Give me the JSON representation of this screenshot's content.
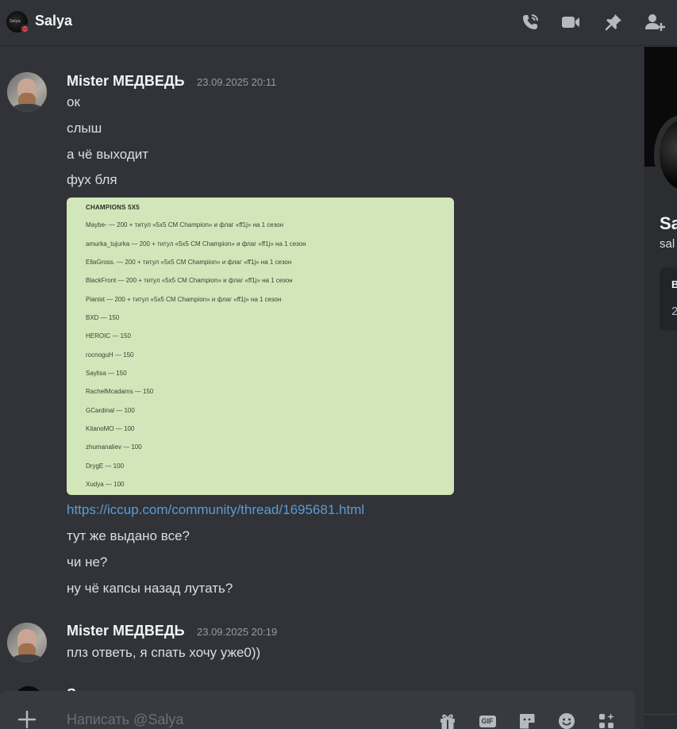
{
  "header": {
    "title": "Salya",
    "avatar_text": "Salya",
    "icons": [
      "phone-call-icon",
      "video-camera-icon",
      "pin-icon",
      "add-friend-icon"
    ]
  },
  "messages": [
    {
      "author": "Mister МЕДВЕДЬ",
      "timestamp": "23.09.2025 20:11",
      "lines": [
        "ок",
        "слыш",
        "а чё выходит",
        "фух бля"
      ],
      "attachment": {
        "title": "CHAMPIONS 5X5",
        "rows": [
          "Maybe- — 200 + титул «5x5 CM Champion» и флаг «ff1j» на 1 сезон",
          "amurka_tujurka — 200 + титул «5x5 CM Champion» и флаг «ff1j» на 1 сезон",
          "EllaGross. — 200 + титул «5x5 CM Champion» и флаг «ff1j» на 1 сезон",
          "BlackFront — 200 + титул «5x5 CM Champion» и флаг «ff1j» на 1 сезон",
          "Pianist — 200 + титул «5x5 CM Champion» и флаг «ff1j» на 1 сезон",
          "BXD — 150",
          "HEROIC — 150",
          "rocnoguH — 150",
          "Saylisa — 150",
          "RachelMcadams — 150",
          "GCardinal — 100",
          "KitanoMO — 100",
          "zhumanaliev — 100",
          "DrygE — 100",
          "Xudya — 100"
        ]
      },
      "link": "https://iccup.com/community/thread/1695681.html",
      "after_lines": [
        "тут же выдано все?",
        "чи не?",
        "ну чё капсы назад лутать?"
      ]
    },
    {
      "author": "Mister МЕДВЕДЬ",
      "timestamp": "23.09.2025 20:19",
      "lines": [
        "плз ответь, я спать хочу уже0))"
      ]
    }
  ],
  "partial_author": "Sa",
  "profile_panel": {
    "name": "Sa",
    "username": "sal",
    "card_heading": "В",
    "card_value": "2"
  },
  "composer": {
    "placeholder": "Написать @Salya",
    "gif_label": "GIF",
    "icons": [
      "add-icon",
      "gift-icon",
      "gif-icon",
      "sticker-icon",
      "emoji-icon",
      "apps-icon"
    ]
  },
  "colors": {
    "background": "#313338",
    "panel": "#2b2d31",
    "composer": "#383a40",
    "link": "#5b9bd5",
    "attachment_bg": "#d2e7b9",
    "status_dnd": "#f23f43"
  }
}
